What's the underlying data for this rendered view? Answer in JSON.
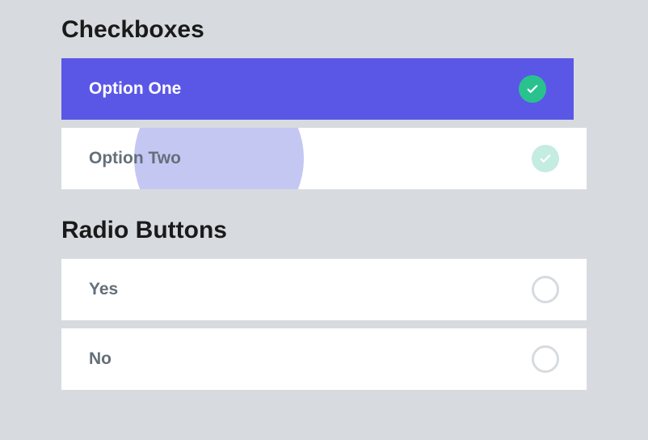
{
  "checkboxes": {
    "heading": "Checkboxes",
    "options": [
      {
        "label": "Option One"
      },
      {
        "label": "Option Two"
      }
    ]
  },
  "radios": {
    "heading": "Radio Buttons",
    "options": [
      {
        "label": "Yes"
      },
      {
        "label": "No"
      }
    ]
  }
}
